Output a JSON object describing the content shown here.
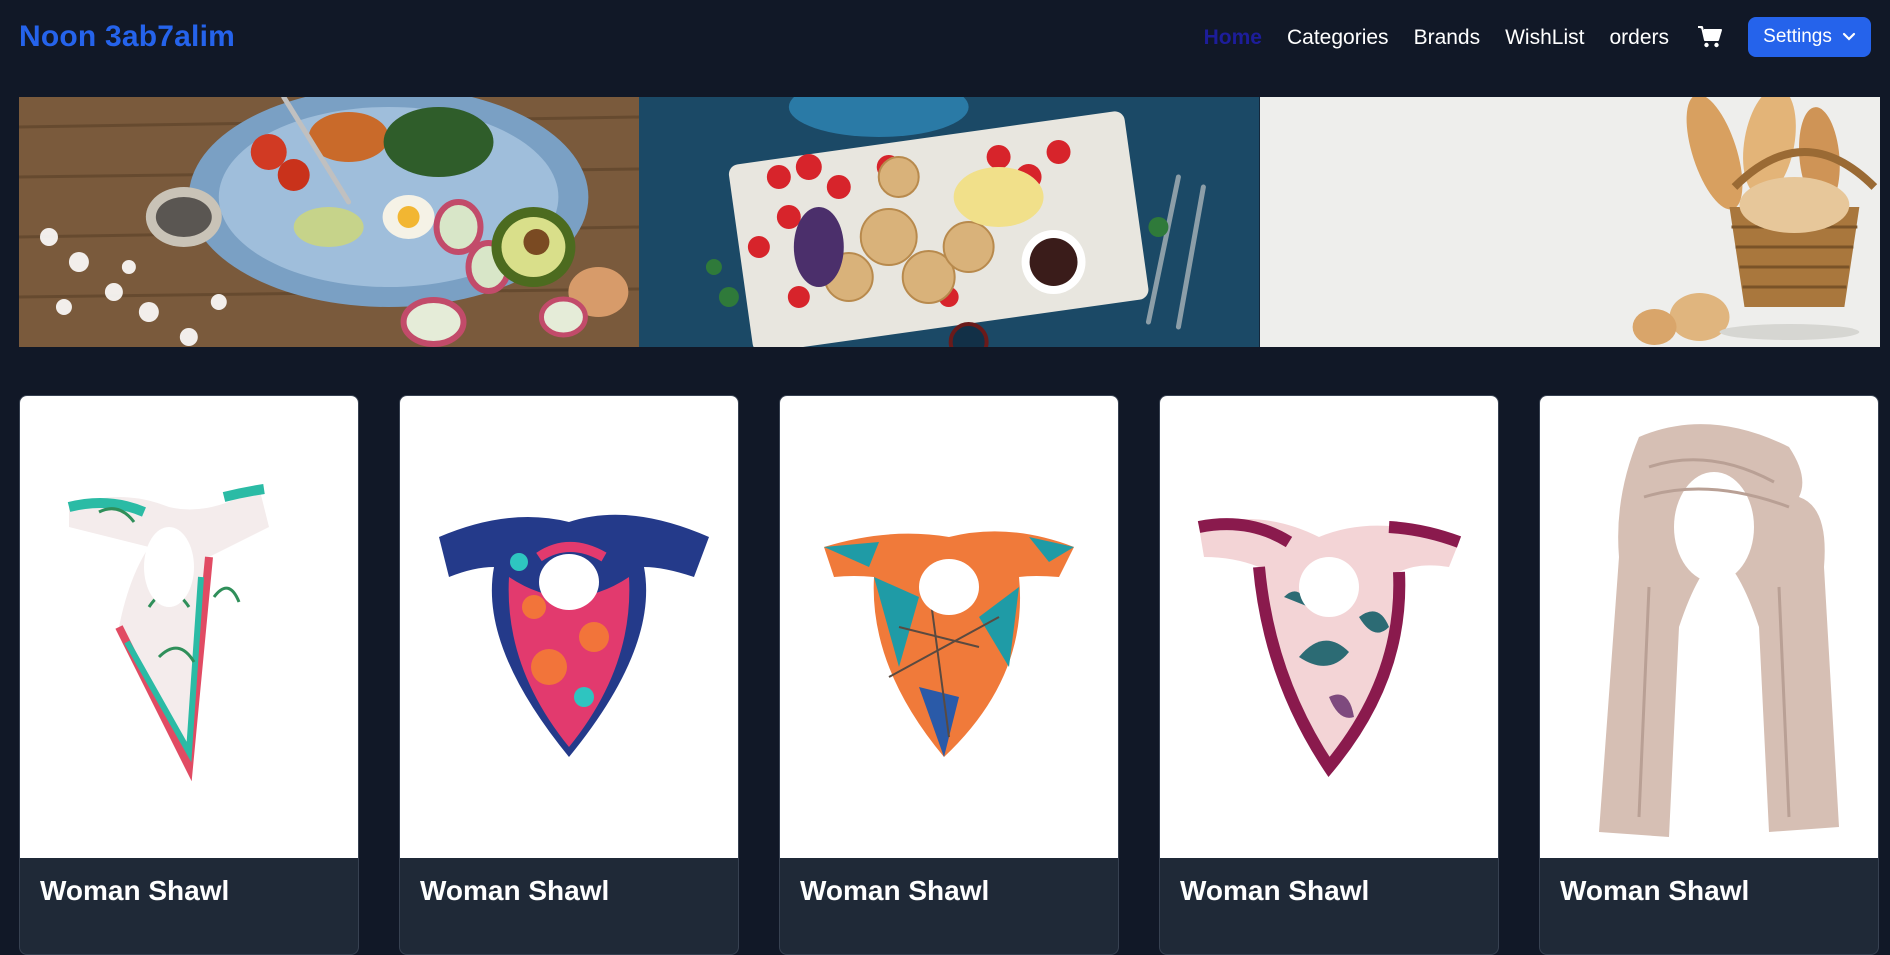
{
  "brand": {
    "name": "Noon 3ab7alim",
    "color": "#2563eb"
  },
  "nav": {
    "links": [
      {
        "label": "Home",
        "active": true
      },
      {
        "label": "Categories",
        "active": false
      },
      {
        "label": "Brands",
        "active": false
      },
      {
        "label": "WishList",
        "active": false
      },
      {
        "label": "orders",
        "active": false
      }
    ],
    "cart_icon": "shopping-cart-icon",
    "settings": {
      "label": "Settings",
      "icon": "chevron-down-icon"
    }
  },
  "slider": {
    "slides": [
      {
        "subject": "food-plate-with-vegetables-and-eggs"
      },
      {
        "subject": "platter-with-strawberries-and-crackers"
      },
      {
        "subject": "bread-basket"
      }
    ]
  },
  "products": [
    {
      "title": "Woman Shawl",
      "image": "floral-scarf"
    },
    {
      "title": "Woman Shawl",
      "image": "blue-pink-scarf"
    },
    {
      "title": "Woman Shawl",
      "image": "orange-teal-scarf"
    },
    {
      "title": "Woman Shawl",
      "image": "purple-pink-scarf"
    },
    {
      "title": "Woman Shawl",
      "image": "beige-long-scarf"
    }
  ],
  "colors": {
    "background": "#111827",
    "accent": "#2563eb",
    "active_link": "#1d1d9a",
    "card_footer": "#1f2937"
  }
}
